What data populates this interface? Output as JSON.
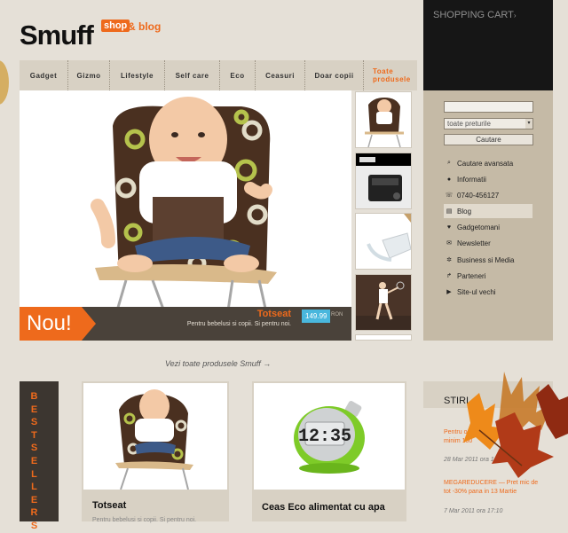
{
  "header": {
    "logo": "Smuff",
    "shop_badge": "shop",
    "blog_text": "& blog"
  },
  "nav": [
    {
      "label": "Gadget"
    },
    {
      "label": "Gizmo"
    },
    {
      "label": "Lifestyle"
    },
    {
      "label": "Self care"
    },
    {
      "label": "Eco"
    },
    {
      "label": "Ceasuri"
    },
    {
      "label": "Doar copii"
    },
    {
      "label": "Toate produsele"
    }
  ],
  "feature": {
    "badge": "Nou!",
    "product_name": "Totseat",
    "product_desc": "Pentru bebelusi si copii. Si pentru noi.",
    "price": "149.99",
    "currency": "RON"
  },
  "cart": {
    "title": "SHOPPING CART",
    "arrow": "›"
  },
  "search": {
    "input_value": "",
    "select_value": "toate preturile",
    "button_label": "Cautare"
  },
  "sidebar_menu": [
    {
      "label": "Cautare avansata",
      "icon": "magnifier-icon"
    },
    {
      "label": "Informatii",
      "icon": "info-icon"
    },
    {
      "label": "0740-456127",
      "icon": "phone-icon"
    },
    {
      "label": "Blog",
      "icon": "blog-icon"
    },
    {
      "label": "Gadgetomani",
      "icon": "heart-icon"
    },
    {
      "label": "Newsletter",
      "icon": "mail-icon"
    },
    {
      "label": "Business si Media",
      "icon": "handshake-icon"
    },
    {
      "label": "Parteneri",
      "icon": "share-icon"
    },
    {
      "label": "Site-ul vechi",
      "icon": "play-icon"
    }
  ],
  "all_products_link": "Vezi toate produsele Smuff →",
  "bestsellers": "BESTSELLERS",
  "cards": [
    {
      "title": "Totseat",
      "desc": "Pentru bebelusi si copii. Si pentru noi."
    },
    {
      "title": "Ceas Eco alimentat cu apa",
      "desc": ""
    }
  ],
  "clock_display": "12:35",
  "news": {
    "title": "STIRI",
    "items": [
      {
        "link": "Pentru orice",
        "link2": "minim 100",
        "date": "28 Mar 2011 ora 1"
      },
      {
        "link": "MEGAREDUCERE — Pret mic de",
        "link2": "tot -30% pana in 13 Martie",
        "date": "7 Mar 2011 ora 17:10"
      }
    ]
  },
  "colors": {
    "accent": "#ee6a1c",
    "dark": "#161616",
    "sidebar": "#c5baa6",
    "price": "#49b7dd",
    "bg": "#e5e0d7"
  }
}
